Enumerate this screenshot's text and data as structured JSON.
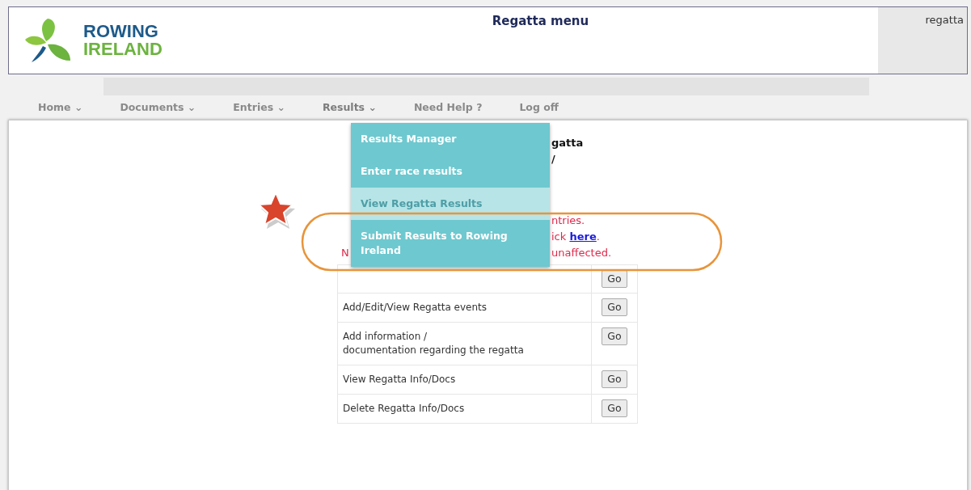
{
  "header": {
    "logo_lines": [
      "ROWING",
      "IRELAND"
    ],
    "title": "Regatta menu",
    "user": "regatta"
  },
  "nav": [
    {
      "label": "Home",
      "caret": "⌄",
      "open": false
    },
    {
      "label": "Documents",
      "caret": "⌄",
      "open": false
    },
    {
      "label": "Entries",
      "caret": "⌄",
      "open": false
    },
    {
      "label": "Results",
      "caret": "⌄",
      "open": true
    },
    {
      "label": "Need Help ?",
      "open": false
    },
    {
      "label": "Log off",
      "open": false
    }
  ],
  "dropdown": {
    "items": [
      {
        "label": "Results Manager",
        "selected": false
      },
      {
        "label": "Enter race results",
        "selected": false
      },
      {
        "label": "View Regatta Results",
        "selected": true
      },
      {
        "label": "Submit Results to Rowing Ireland",
        "selected": false
      }
    ]
  },
  "page_heading": [
    "gatta",
    "/"
  ],
  "notice": [
    {
      "right": "ntries."
    },
    {
      "right": "ick ",
      "link": "here",
      "after": "."
    },
    {
      "left": "N",
      "right": "unaffected."
    }
  ],
  "menu_table": {
    "rows": [
      {
        "button": "Go"
      },
      {
        "label": "Add/Edit/View Regatta events",
        "button": "Go"
      },
      {
        "label": "Add information /\ndocumentation regarding the regatta",
        "button": "Go"
      },
      {
        "label": "View Regatta Info/Docs",
        "button": "Go"
      },
      {
        "label": "Delete Regatta Info/Docs",
        "button": "Go"
      }
    ]
  }
}
